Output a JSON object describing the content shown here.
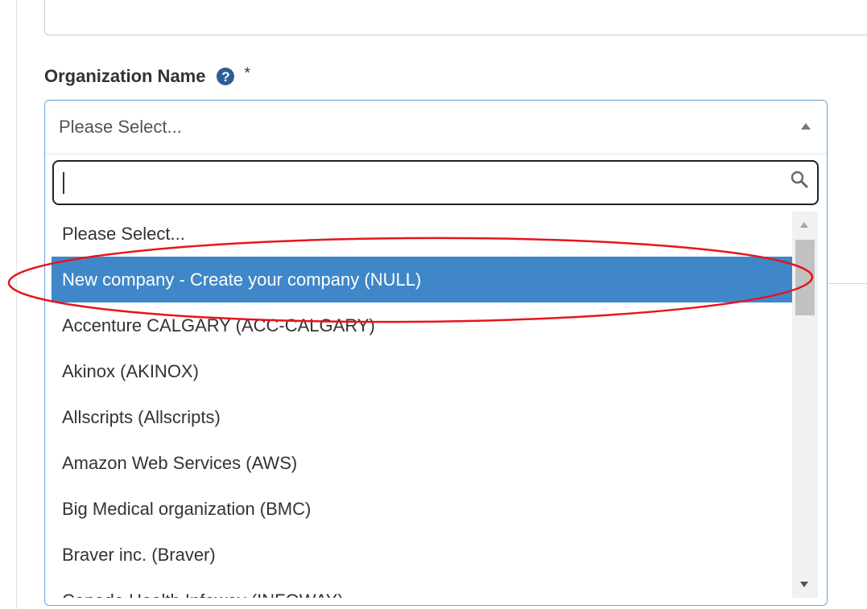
{
  "form": {
    "field_label": "Organization Name",
    "help_icon": "question-circle-icon",
    "required_marker": "*"
  },
  "select": {
    "selected_value": "Please Select...",
    "search": {
      "value": "",
      "placeholder": ""
    },
    "options": [
      "Please Select...",
      "New company - Create your company (NULL)",
      "Accenture CALGARY (ACC-CALGARY)",
      "Akinox (AKINOX)",
      "Allscripts (Allscripts)",
      "Amazon Web Services (AWS)",
      "Big Medical organization (BMC)",
      "Braver inc. (Braver)",
      "Canada Health Infoway (INFOWAY)"
    ],
    "highlighted_option": "New company - Create your company (NULL)"
  },
  "annotation": {
    "color": "#e8141b",
    "shape": "ellipse"
  },
  "colors": {
    "highlight": "#3f87c9",
    "focus_border": "#66a3e0",
    "help_icon": "#2e5f93"
  }
}
